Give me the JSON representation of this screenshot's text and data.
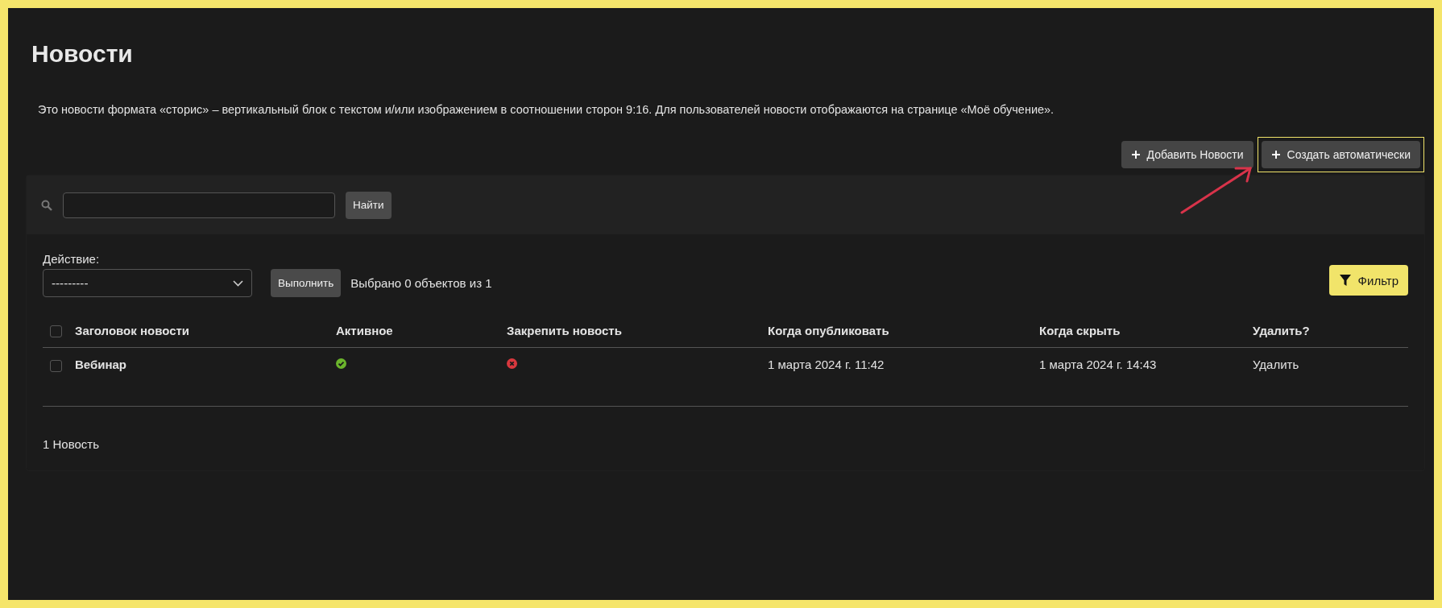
{
  "title": "Новости",
  "description": "Это новости формата «сторис» – вертикальный блок с текстом и/или изображением в соотношении сторон 9:16. Для пользователей новости отображаются на странице «Моё обучение».",
  "toolbar_buttons": [
    {
      "label": "Добавить Новости",
      "highlighted": false
    },
    {
      "label": "Создать автоматически",
      "highlighted": true
    }
  ],
  "search": {
    "button": "Найти"
  },
  "action": {
    "label": "Действие:",
    "value": "---------",
    "button": "Выполнить",
    "selection_info": "Выбрано 0 объектов из 1"
  },
  "filter_button": "Фильтр",
  "table": {
    "select_all_checked": false,
    "columns": [
      "Заголовок новости",
      "Активное",
      "Закрепить новость",
      "Когда опубликовать",
      "Когда скрыть",
      "Удалить?"
    ],
    "rows": [
      {
        "checked": false,
        "title": "Вебинар",
        "active": true,
        "pinned": false,
        "publish_at": "1 марта 2024 г. 11:42",
        "hide_at": "1 марта 2024 г. 14:43",
        "delete": "Удалить"
      }
    ]
  },
  "footer": "1 Новость"
}
